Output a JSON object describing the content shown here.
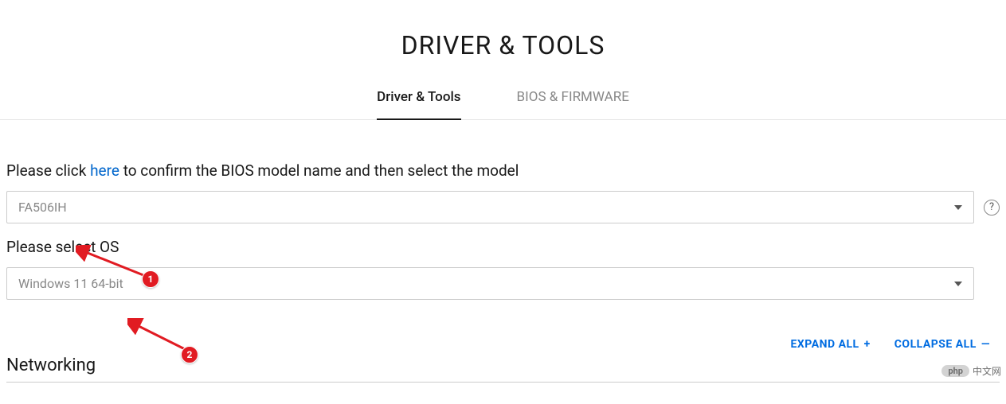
{
  "header": {
    "title": "DRIVER & TOOLS"
  },
  "tabs": {
    "driver_tools": "Driver & Tools",
    "bios_firmware": "BIOS & FIRMWARE"
  },
  "instruction": {
    "prefix": "Please click ",
    "link": "here",
    "suffix": " to confirm the BIOS model name and then select the model"
  },
  "model_select": {
    "value": "FA506IH",
    "help_symbol": "?"
  },
  "os_label": "Please select OS",
  "os_select": {
    "value": "Windows 11 64-bit"
  },
  "controls": {
    "expand": "EXPAND ALL",
    "expand_icon": "+",
    "collapse": "COLLAPSE ALL",
    "collapse_icon": "—"
  },
  "section": {
    "title": "Networking"
  },
  "annotations": {
    "badge1": "1",
    "badge2": "2"
  },
  "watermark": {
    "php": "php",
    "cn": "中文网"
  }
}
